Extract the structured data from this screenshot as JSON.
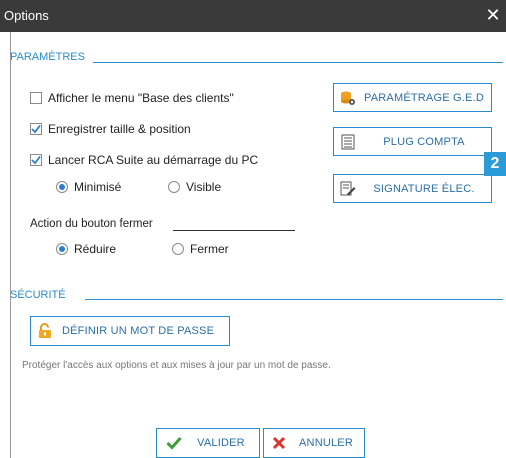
{
  "window": {
    "title": "Options",
    "close_glyph": "✕"
  },
  "parametres": {
    "title": "PARAMÈTRES",
    "show_clients_menu": {
      "label": "Afficher le menu \"Base des clients\"",
      "checked": false
    },
    "save_size_position": {
      "label": "Enregistrer taille & position",
      "checked": true
    },
    "launch_at_startup": {
      "label": "Lancer RCA Suite au démarrage du PC",
      "checked": true
    },
    "startup_mode": {
      "options": [
        {
          "label": "Minimisé",
          "selected": true
        },
        {
          "label": "Visible",
          "selected": false
        }
      ]
    },
    "close_action": {
      "title": "Action du bouton fermer",
      "options": [
        {
          "label": "Réduire",
          "selected": true
        },
        {
          "label": "Fermer",
          "selected": false
        }
      ]
    },
    "buttons": {
      "ged": {
        "label": "PARAMÉTRAGE G.E.D",
        "icon": "database-gear-icon"
      },
      "compta": {
        "label": "PLUG COMPTA",
        "icon": "spreadsheet-icon"
      },
      "signature": {
        "label": "SIGNATURE ÉLEC.",
        "icon": "document-sign-icon"
      }
    },
    "badge": "2"
  },
  "securite": {
    "title": "SÉCURITÉ",
    "password_button": {
      "label": "DÉFINIR UN MOT DE PASSE",
      "icon": "padlock-icon"
    },
    "hint": "Protéger l'accès aux options et aux mises à jour par un mot de passe."
  },
  "footer": {
    "validate": {
      "label": "VALIDER",
      "icon": "check-icon"
    },
    "cancel": {
      "label": "ANNULER",
      "icon": "x-icon"
    }
  },
  "colors": {
    "accent": "#2a8ccd",
    "titlebar": "#3a3a3a",
    "check": "#2a7fd0",
    "cancel": "#d9342b",
    "validate": "#3f9e3a",
    "badge": "#2a9bd8"
  }
}
